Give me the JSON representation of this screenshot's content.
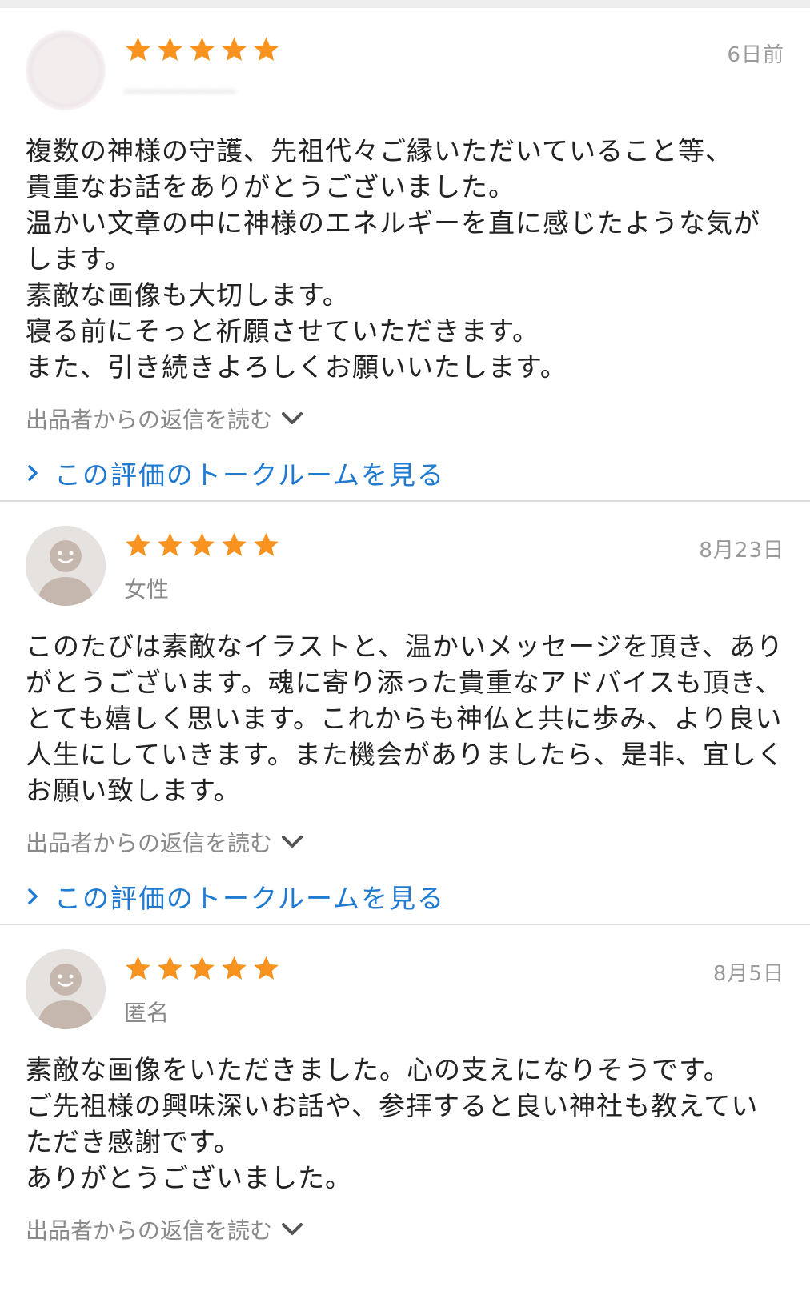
{
  "reviews": [
    {
      "date": "6日前",
      "user": "",
      "rating": 5,
      "text": "複数の神様の守護、先祖代々ご縁いただいていること等、\n貴重なお話をありがとうございました。\n温かい文章の中に神様のエネルギーを直に感じたような気がします。\n素敵な画像も大切します。\n寝る前にそっと祈願させていただきます。\nまた、引き続きよろしくお願いいたします。",
      "reply_label": "出品者からの返信を読む",
      "talk_label": "この評価のトークルームを見る"
    },
    {
      "date": "8月23日",
      "user": "女性",
      "rating": 5,
      "text": "このたびは素敵なイラストと、温かいメッセージを頂き、ありがとうございます。魂に寄り添った貴重なアドバイスも頂き、とても嬉しく思います。これからも神仏と共に歩み、より良い人生にしていきます。また機会がありましたら、是非、宜しくお願い致します。",
      "reply_label": "出品者からの返信を読む",
      "talk_label": "この評価のトークルームを見る"
    },
    {
      "date": "8月5日",
      "user": "匿名",
      "rating": 5,
      "text": "素敵な画像をいただきました。心の支えになりそうです。\nご先祖様の興味深いお話や、参拝すると良い神社も教えていただき感謝です。\nありがとうございました。",
      "reply_label": "出品者からの返信を読む"
    }
  ],
  "colors": {
    "star": "#f7931e",
    "link": "#1f7ad1",
    "muted": "#8a8a8a",
    "divider": "#dcdcdc"
  },
  "icons": {
    "star": "star-icon",
    "reply": "chevron-down-icon",
    "talk": "chevron-right-icon",
    "avatar": "default-avatar-icon"
  }
}
